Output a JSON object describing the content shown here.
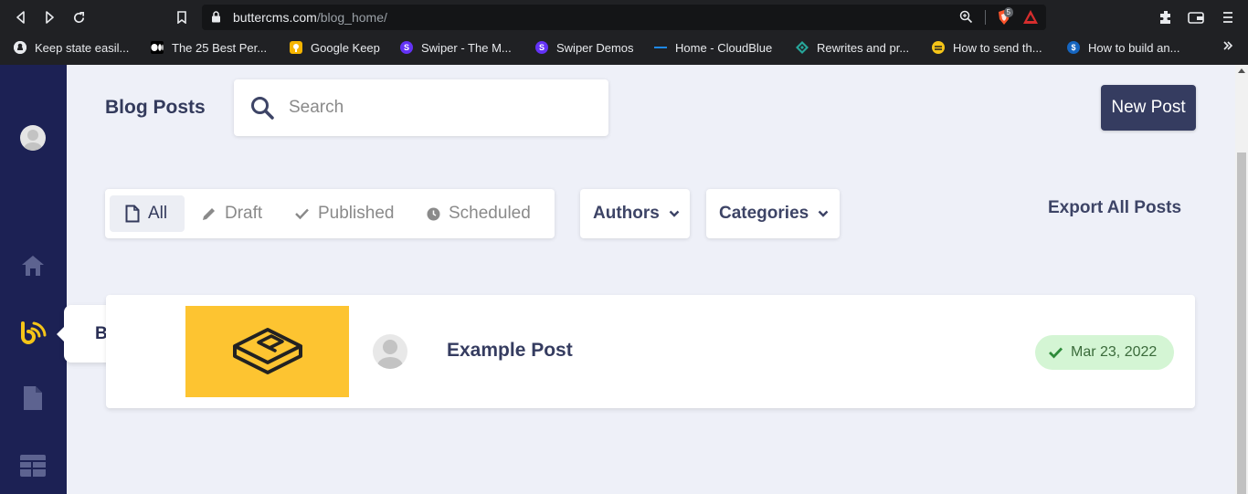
{
  "browser": {
    "url_domain": "buttercms.com",
    "url_path": "/blog_home/",
    "shield_count": "5",
    "bookmarks": [
      {
        "label": "Keep state easil...",
        "icon": "github-icon",
        "color": "#e8eaed"
      },
      {
        "label": "The 25 Best Per...",
        "icon": "medium-icon",
        "color": "#000000"
      },
      {
        "label": "Google Keep",
        "icon": "google-keep-icon",
        "color": "#f5b400"
      },
      {
        "label": "Swiper - The M...",
        "icon": "swiper-icon",
        "color": "#6332f6"
      },
      {
        "label": "Swiper Demos",
        "icon": "swiper-icon",
        "color": "#6332f6"
      },
      {
        "label": "Home - CloudBlue",
        "icon": "cloudblue-icon",
        "color": "#1e88e5"
      },
      {
        "label": "Rewrites and pr...",
        "icon": "rewrites-icon",
        "color": "#27a69a"
      },
      {
        "label": "How to send th...",
        "icon": "bee-icon",
        "color": "#f5c518"
      },
      {
        "label": "How to build an...",
        "icon": "blue-s-icon",
        "color": "#1565c0"
      }
    ]
  },
  "sidebar": {
    "tooltip": "Blog posts",
    "accent_color": "#f5c518",
    "bg_color": "#1c2154"
  },
  "header": {
    "title": "Blog Posts",
    "search_placeholder": "Search",
    "new_post_label": "New Post"
  },
  "filters": {
    "tabs": [
      "All",
      "Draft",
      "Published",
      "Scheduled"
    ],
    "active": "All"
  },
  "dropdowns": {
    "authors": "Authors",
    "categories": "Categories"
  },
  "export_label": "Export All Posts",
  "posts": [
    {
      "title": "Example Post",
      "date": "Mar 23, 2022",
      "status": "published"
    }
  ]
}
